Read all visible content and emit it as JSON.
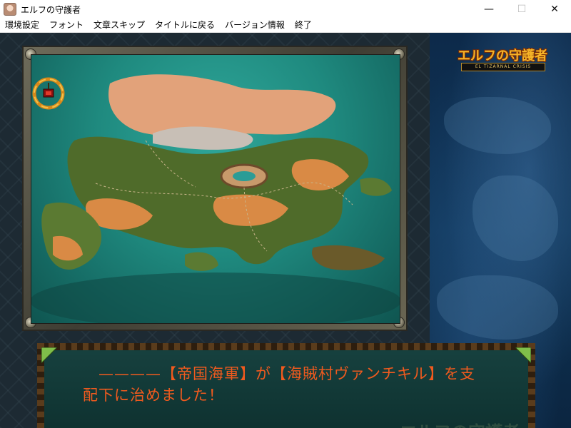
{
  "window": {
    "title": "エルフの守護者",
    "minimize_glyph": "—",
    "maximize_glyph": "☐",
    "close_glyph": "✕"
  },
  "menu": {
    "items": [
      "環境設定",
      "フォント",
      "文章スキップ",
      "タイトルに戻る",
      "バージョン情報",
      "終了"
    ]
  },
  "logo": {
    "title": "エルフの守護者",
    "subtitle": "EL TIZARNAL CRISIS"
  },
  "dialog": {
    "line1": "　————【帝国海軍】が【海賊村ヴァンチキル】を支",
    "line2": "配下に治めました！",
    "watermark": "エルフの守護者"
  },
  "colors": {
    "dialog_text": "#f05a1e",
    "logo_gold": "#f5b428",
    "map_sea": "#1f8a7f"
  },
  "icons": {
    "app": "elf-portrait-icon",
    "compass": "compass-flag-icon"
  }
}
